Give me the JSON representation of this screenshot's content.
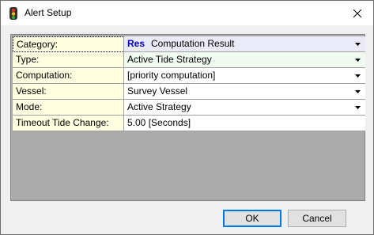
{
  "window": {
    "title": "Alert Setup"
  },
  "fields": [
    {
      "label": "Category:",
      "tag": "Res",
      "value": "Computation Result",
      "dropdown": true
    },
    {
      "label": "Type:",
      "value": "Active Tide Strategy",
      "dropdown": true
    },
    {
      "label": "Computation:",
      "value": "[priority computation]",
      "dropdown": true
    },
    {
      "label": "Vessel:",
      "value": "Survey Vessel",
      "dropdown": true
    },
    {
      "label": "Mode:",
      "value": "Active Strategy",
      "dropdown": true
    },
    {
      "label": "Timeout Tide Change:",
      "value": "5.00 [Seconds]",
      "dropdown": false
    }
  ],
  "buttons": {
    "ok": "OK",
    "cancel": "Cancel"
  },
  "icons": {
    "app": "traffic-light-icon",
    "close": "close-icon",
    "dropdown": "chevron-down-icon"
  },
  "colors": {
    "label_bg": "#ffffe1",
    "tag": "#0000cc",
    "default_button_border": "#0078d7"
  }
}
